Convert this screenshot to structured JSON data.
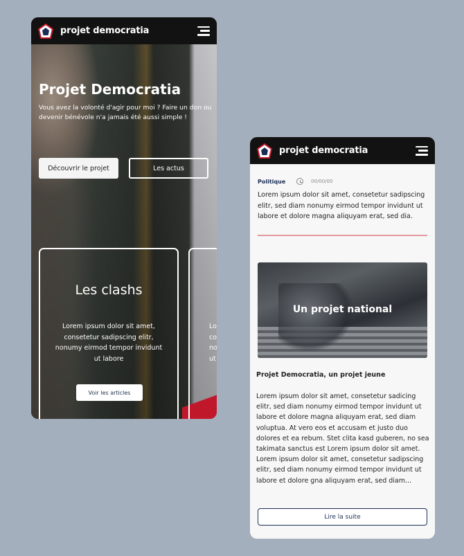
{
  "brand": {
    "name": "projet democratia",
    "colors": {
      "navy": "#1b2d55",
      "red": "#c0182a",
      "header": "#121212"
    }
  },
  "home": {
    "title": "Projet Democratia",
    "subtitle": "Vous avez la volonté d'agir pour moi ? Faire un don ou devenir bénévole n'a jamais été aussi simple !",
    "discover_label": "Découvrir le projet",
    "news_label": "Les actus",
    "cards": [
      {
        "title": "Les clashs",
        "text": "Lorem ipsum dolor sit amet, consetetur sadipscing elitr, nonumy eirmod tempor invidunt ut labore",
        "button": "Voir les articles"
      },
      {
        "title": "",
        "text": "Lorem ipsum dolor sit amet, consetetur sadipscing elitr, nonumy eirmod tempor invidunt ut labore",
        "button": ""
      }
    ]
  },
  "article": {
    "category": "Politique",
    "date": "00/00/00",
    "excerpt": "Lorem ipsum dolor sit amet, consetetur sadipscing elitr, sed diam nonumy eirmod tempor invidunt ut labore et dolore magna aliquyam erat, sed dia.",
    "image_title": "Un projet national",
    "section_title": "Projet Democratia, un projet jeune",
    "body": "Lorem ipsum dolor sit amet, consetetur sadicing elitr, sed diam nonumy eirmod tempor invidunt ut labore et dolore magna aliquyam erat, sed diam voluptua. At vero eos et accusam et justo duo dolores et ea rebum. Stet clita kasd guberen, no sea takimata sanctus est Lorem ipsum dolor sit amet. Lorem ipsum dolor sit amet, consetetur sadipscing elitr, sed diam nonumy eirmod tempor invidunt ut labore et dolore gna aliquyam erat, sed diam...",
    "read_more_label": "Lire la suite"
  }
}
